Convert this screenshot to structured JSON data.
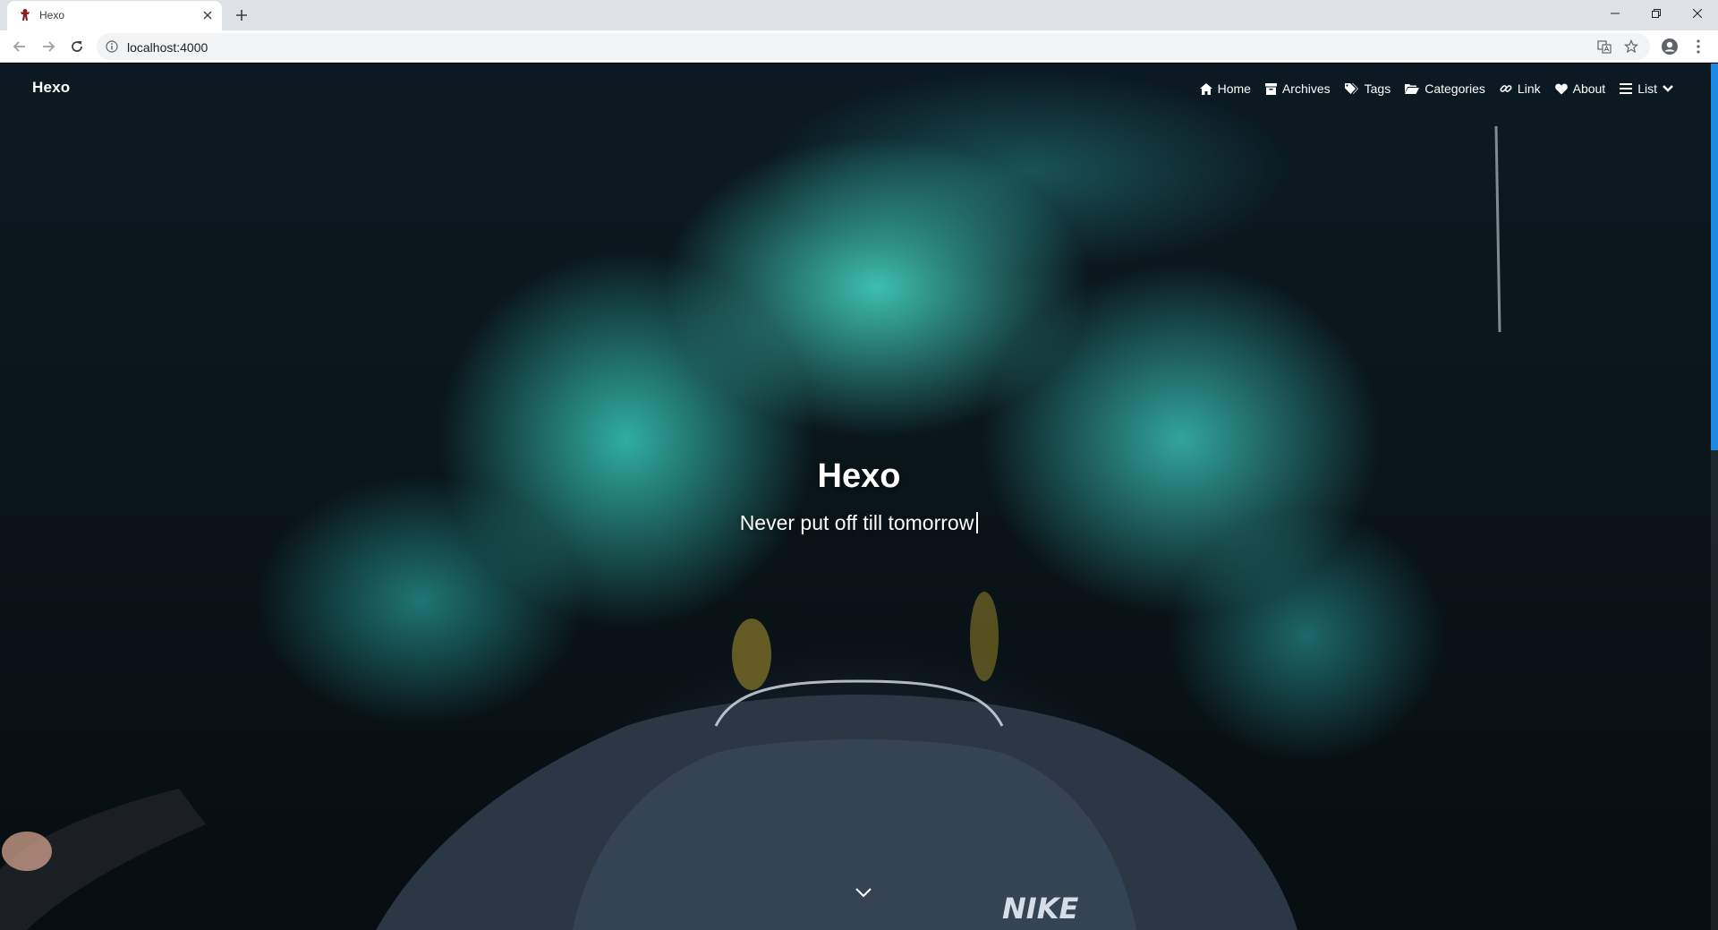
{
  "browser": {
    "tab_title": "Hexo",
    "url": "localhost:4000"
  },
  "site": {
    "brand": "Hexo",
    "menu": [
      {
        "label": "Home",
        "icon": "home-icon"
      },
      {
        "label": "Archives",
        "icon": "archive-icon"
      },
      {
        "label": "Tags",
        "icon": "tags-icon"
      },
      {
        "label": "Categories",
        "icon": "folder-icon"
      },
      {
        "label": "Link",
        "icon": "link-icon"
      },
      {
        "label": "About",
        "icon": "heart-icon"
      },
      {
        "label": "List",
        "icon": "list-icon"
      }
    ],
    "hero": {
      "title": "Hexo",
      "subtitle": "Never put off till tomorrow"
    }
  },
  "colors": {
    "accent": "#1e88e5",
    "smoke": "#46dcc8"
  }
}
